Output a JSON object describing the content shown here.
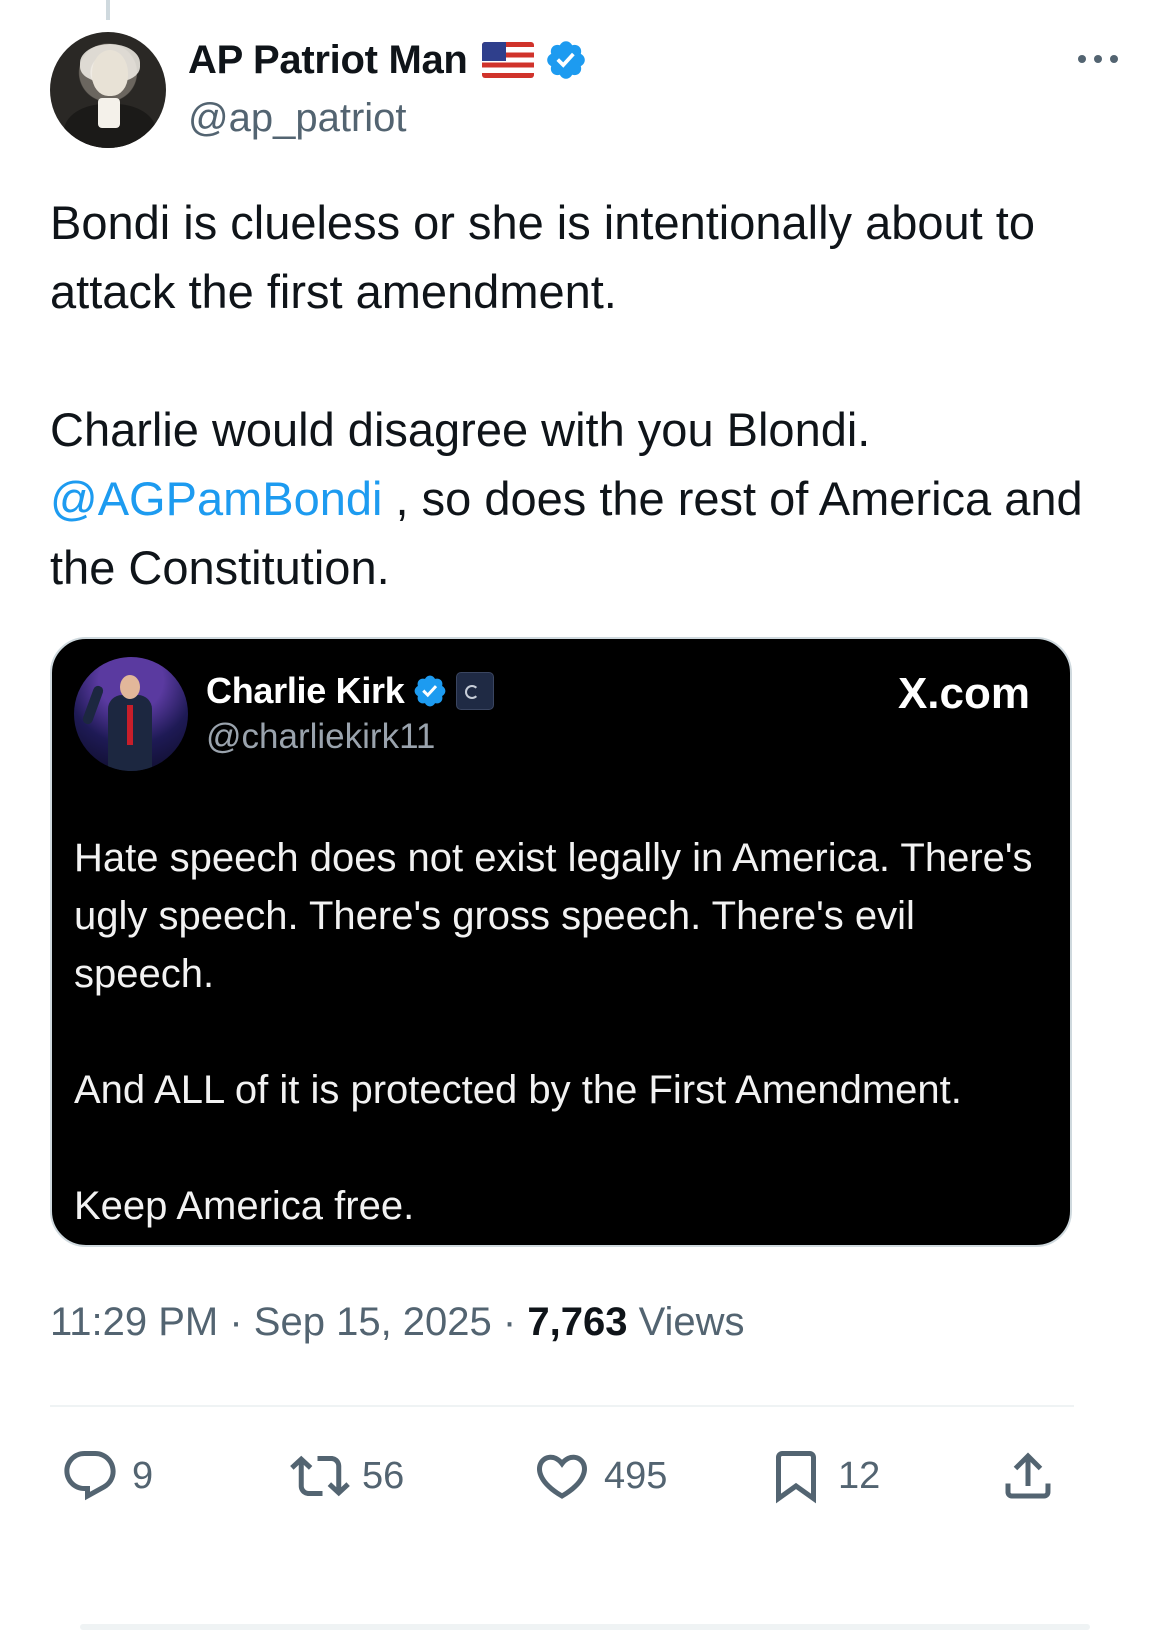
{
  "post": {
    "author": {
      "display_name": "AP Patriot Man",
      "handle": "@ap_patriot",
      "flag": "us-flag-emoji",
      "verified": true
    },
    "text": {
      "line1": "Bondi is clueless or she is intentionally about to attack the first amendment.",
      "line2": "Charlie would disagree with you Blondi.",
      "mention": "@AGPamBondi",
      "line3_rest": " , so does the rest of America and the Constitution."
    },
    "quote": {
      "display_name": "Charlie Kirk",
      "handle": "@charliekirk11",
      "source": "X.com",
      "paragraphs": [
        "Hate speech does not exist legally in America. There's ugly speech. There's gross speech. There's evil speech.",
        "And ALL of it is protected by the First Amendment.",
        "Keep America free."
      ]
    },
    "meta": {
      "time": "11:29 PM",
      "separator": " · ",
      "date": "Sep 15, 2025",
      "views_count": "7,763",
      "views_label": " Views"
    },
    "actions": {
      "replies": "9",
      "reposts": "56",
      "likes": "495",
      "bookmarks": "12"
    }
  },
  "colors": {
    "text_primary": "#0f1419",
    "text_secondary": "#536471",
    "accent": "#1d9bf0",
    "quote_bg": "#000000"
  }
}
